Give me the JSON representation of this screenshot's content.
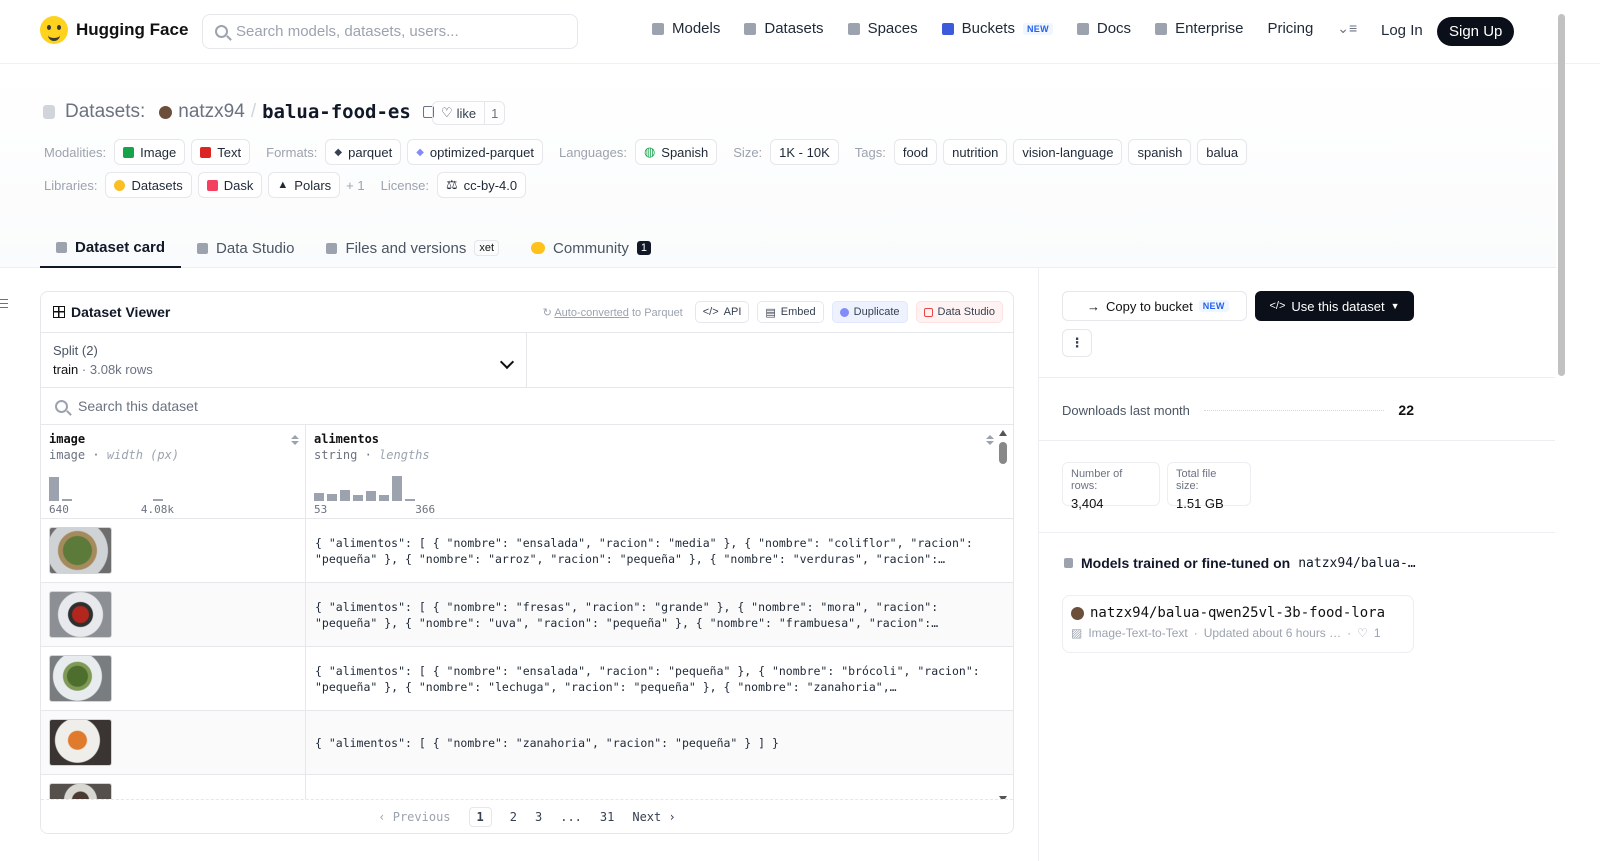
{
  "header": {
    "brand": "Hugging Face",
    "search_placeholder": "Search models, datasets, users...",
    "nav": [
      {
        "label": "Models",
        "icon": "cube-icon"
      },
      {
        "label": "Datasets",
        "icon": "database-icon"
      },
      {
        "label": "Spaces",
        "icon": "grid-icon"
      },
      {
        "label": "Buckets",
        "icon": "bucket-icon",
        "badge": "NEW"
      },
      {
        "label": "Docs",
        "icon": "book-icon"
      },
      {
        "label": "Enterprise",
        "icon": "enterprise-icon"
      },
      {
        "label": "Pricing"
      }
    ],
    "login": "Log In",
    "signup": "Sign Up"
  },
  "repo": {
    "section": "Datasets:",
    "user": "natzx94",
    "separator": "/",
    "name": "balua-food-es",
    "like_label": "like",
    "like_count": "1"
  },
  "meta": {
    "modalities_label": "Modalities:",
    "modalities": [
      "Image",
      "Text"
    ],
    "formats_label": "Formats:",
    "formats": [
      "parquet",
      "optimized-parquet"
    ],
    "languages_label": "Languages:",
    "languages": [
      "Spanish"
    ],
    "size_label": "Size:",
    "size": "1K - 10K",
    "tags_label": "Tags:",
    "tags": [
      "food",
      "nutrition",
      "vision-language",
      "spanish",
      "balua"
    ],
    "libraries_label": "Libraries:",
    "libraries": [
      "Datasets",
      "Dask",
      "Polars"
    ],
    "libraries_more": "+ 1",
    "license_label": "License:",
    "license": "cc-by-4.0"
  },
  "tabs": [
    {
      "label": "Dataset card",
      "active": true
    },
    {
      "label": "Data Studio"
    },
    {
      "label": "Files and versions",
      "badge": "xet"
    },
    {
      "label": "Community",
      "badge": "1"
    }
  ],
  "viewer": {
    "title": "Dataset Viewer",
    "auto_converted_link": "Auto-converted",
    "auto_converted_rest": "to Parquet",
    "actions": [
      "API",
      "Embed",
      "Duplicate",
      "Data Studio"
    ],
    "split_label": "Split (2)",
    "split_value": "train",
    "split_rows": "3.08k rows",
    "search_placeholder": "Search this dataset",
    "columns": [
      {
        "name": "image",
        "type": "image",
        "stat": "width (px)",
        "min": "640",
        "max": "4.08k",
        "hist": [
          0.85,
          0.05,
          0,
          0,
          0,
          0,
          0,
          0,
          0.05
        ]
      },
      {
        "name": "alimentos",
        "type": "string",
        "stat": "lengths",
        "min": "53",
        "max": "366",
        "hist": [
          0.3,
          0.25,
          0.4,
          0.2,
          0.35,
          0.2,
          0.9,
          0.05
        ]
      }
    ],
    "rows": [
      {
        "alimentos": "{ \"alimentos\": [ { \"nombre\": \"ensalada\", \"racion\": \"media\" }, { \"nombre\": \"coliflor\", \"racion\": \"pequeña\" }, { \"nombre\": \"arroz\", \"racion\": \"pequeña\" }, { \"nombre\": \"verduras\", \"racion\":…"
      },
      {
        "alimentos": "{ \"alimentos\": [ { \"nombre\": \"fresas\", \"racion\": \"grande\" }, { \"nombre\": \"mora\", \"racion\": \"pequeña\" }, { \"nombre\": \"uva\", \"racion\": \"pequeña\" }, { \"nombre\": \"frambuesa\", \"racion\":…"
      },
      {
        "alimentos": "{ \"alimentos\": [ { \"nombre\": \"ensalada\", \"racion\": \"pequeña\" }, { \"nombre\": \"brócoli\", \"racion\": \"pequeña\" }, { \"nombre\": \"lechuga\", \"racion\": \"pequeña\" }, { \"nombre\": \"zanahoria\",…"
      },
      {
        "alimentos": "{ \"alimentos\": [ { \"nombre\": \"zanahoria\", \"racion\": \"pequeña\" } ] }"
      }
    ],
    "pager": {
      "previous": "Previous",
      "pages": [
        "1",
        "2",
        "3",
        "...",
        "31"
      ],
      "next": "Next"
    }
  },
  "sidebar": {
    "copy_bucket": "Copy to bucket",
    "copy_badge": "NEW",
    "use_dataset": "Use this dataset",
    "downloads_label": "Downloads last month",
    "downloads_value": "22",
    "rows_label": "Number of rows:",
    "rows_value": "3,404",
    "size_label": "Total file size:",
    "size_value": "1.51 GB",
    "models_title": "Models trained or fine-tuned on",
    "models_repo": "natzx94/balua-…",
    "model": {
      "name": "natzx94/balua-qwen25vl-3b-food-lora",
      "task": "Image-Text-to-Text",
      "updated": "Updated about 6 hours …",
      "likes": "1"
    }
  }
}
